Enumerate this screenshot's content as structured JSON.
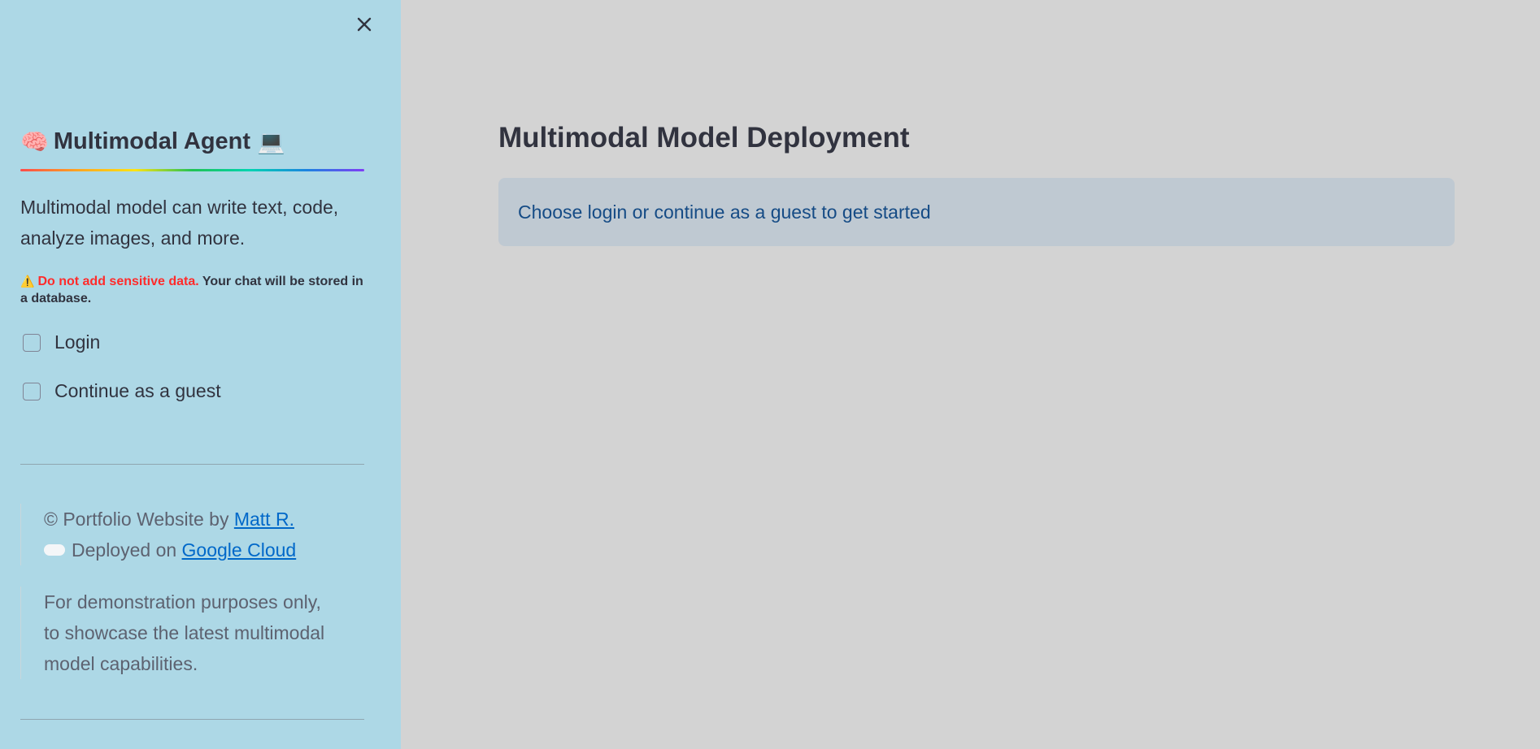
{
  "sidebar": {
    "close_label": "close sidebar",
    "title_emoji_left": "🧠",
    "title": "Multimodal Agent",
    "title_emoji_right": "💻",
    "description": "Multimodal model can write text, code, analyze images, and more.",
    "warning_icon": "⚠️",
    "warning_red": "Do not add sensitive data.",
    "warning_rest": "Your chat will be stored in a database.",
    "checkboxes": [
      {
        "label": "Login",
        "checked": false
      },
      {
        "label": "Continue as a guest",
        "checked": false
      }
    ],
    "footer": {
      "portfolio_prefix": "© Portfolio Website by",
      "portfolio_link": "Matt R.",
      "deployed_prefix": "Deployed on",
      "deployed_link": "Google Cloud",
      "demo_note": "For demonstration purposes only, to showcase the latest multimodal model capabilities."
    }
  },
  "main": {
    "title": "Multimodal Model Deployment",
    "info_message": "Choose login or continue as a guest to get started"
  },
  "colors": {
    "sidebar_bg": "#add8e6",
    "main_bg": "#d3d3d3",
    "info_bg": "#bfc9d2",
    "info_text": "#154b85",
    "warning_red": "#ff2b2b",
    "link": "#0068c9"
  },
  "icons": {
    "close": "close-icon",
    "brain": "brain-icon",
    "laptop": "laptop-icon",
    "warning": "warning-icon",
    "cloud": "cloud-icon"
  }
}
